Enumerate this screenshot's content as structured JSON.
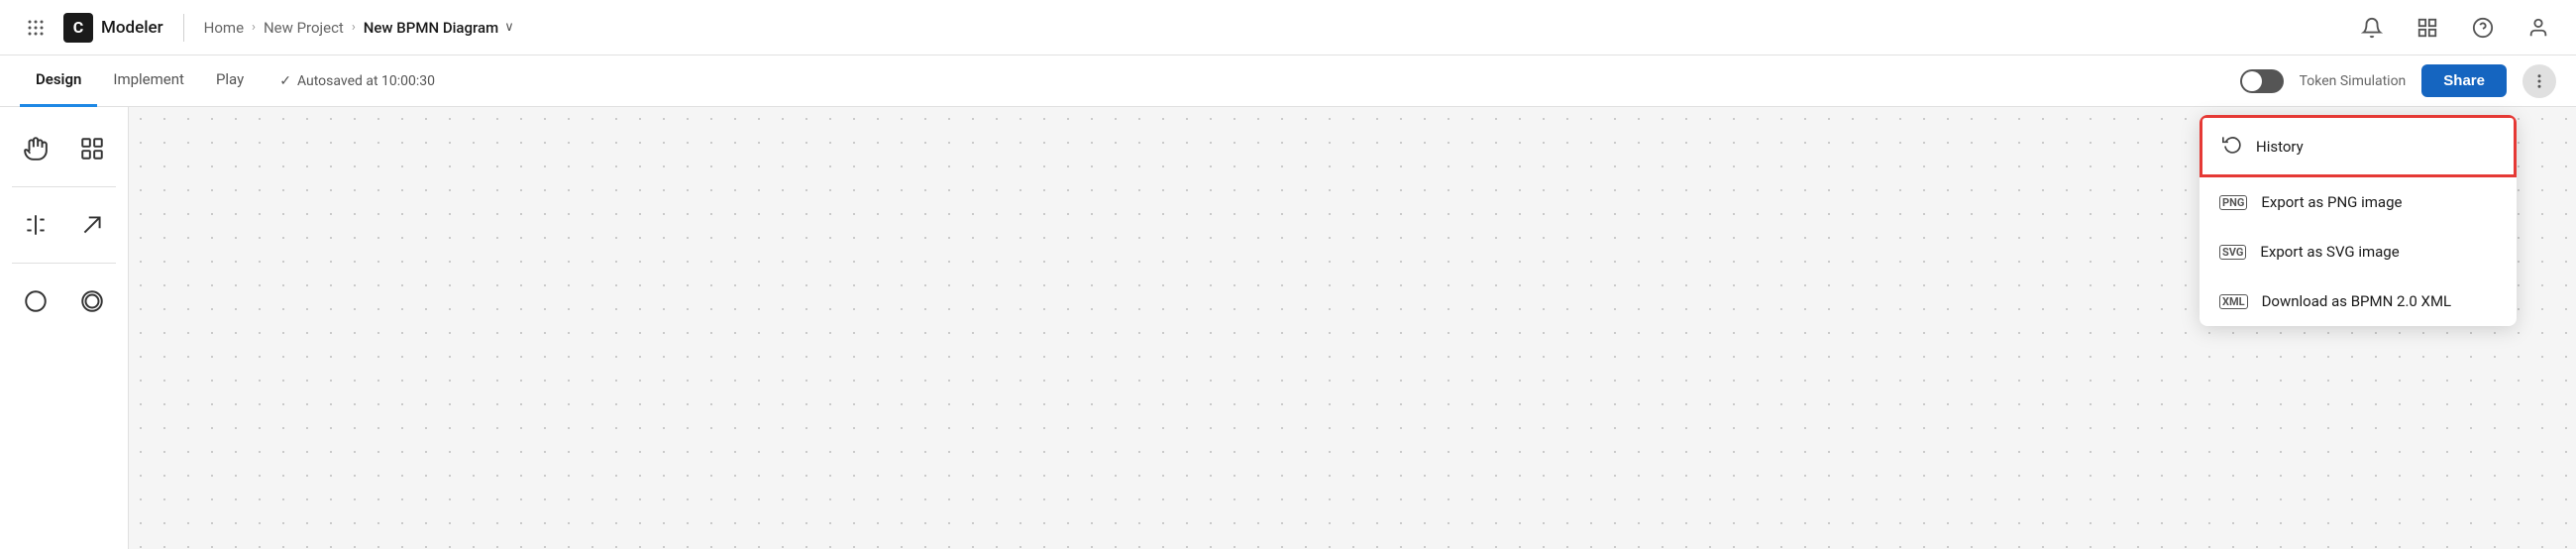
{
  "app": {
    "grid_icon": "⠿",
    "logo_letter": "C",
    "logo_label": "Modeler"
  },
  "breadcrumb": {
    "home": "Home",
    "sep1": "›",
    "project": "New Project",
    "sep2": "›",
    "current": "New BPMN Diagram",
    "chevron": "∨"
  },
  "nav_icons": {
    "bell": "🔔",
    "grid": "⊞",
    "help": "?",
    "user": "○"
  },
  "tabs": [
    {
      "label": "Design",
      "active": true
    },
    {
      "label": "Implement",
      "active": false
    },
    {
      "label": "Play",
      "active": false
    }
  ],
  "autosave": {
    "icon": "✓",
    "text": "Autosaved at 10:00:30"
  },
  "toolbar": {
    "token_simulation_label": "Token Simulation",
    "share_label": "Share",
    "more_label": "···"
  },
  "tools": {
    "hand": "✋",
    "select": "⊡",
    "split": "⊟",
    "arrow": "↗",
    "circle": "○",
    "double_circle": "◎"
  },
  "dropdown": {
    "items": [
      {
        "icon_type": "history",
        "label": "History",
        "highlighted": true
      },
      {
        "icon_type": "png",
        "label": "Export as PNG image",
        "highlighted": false
      },
      {
        "icon_type": "svg",
        "label": "Export as SVG image",
        "highlighted": false
      },
      {
        "icon_type": "xml",
        "label": "Download as BPMN 2.0 XML",
        "highlighted": false
      }
    ]
  }
}
